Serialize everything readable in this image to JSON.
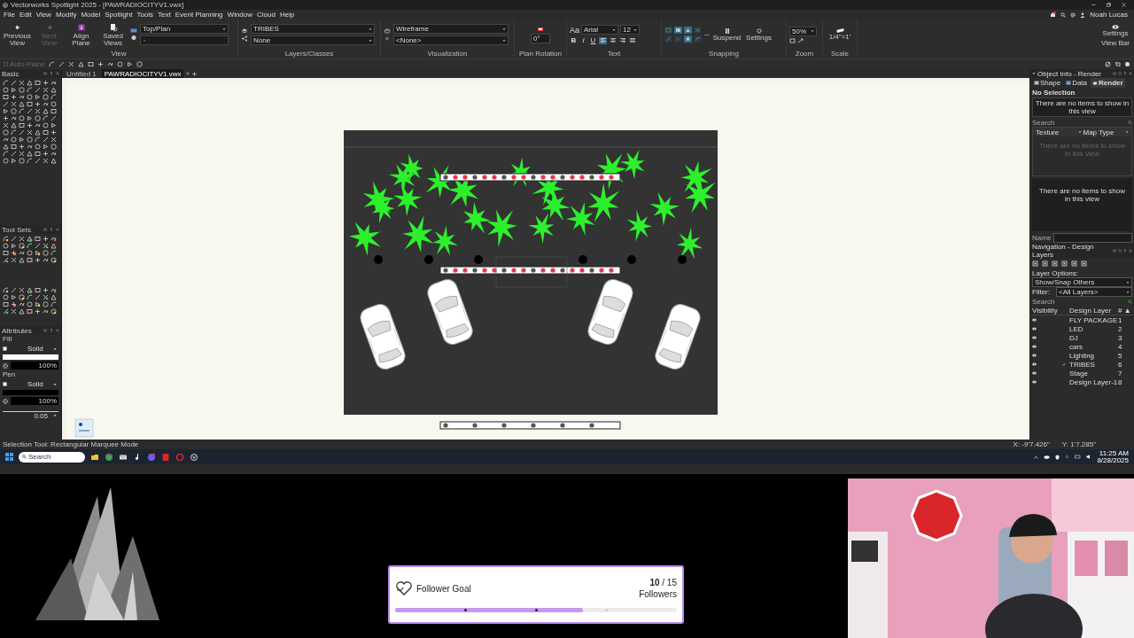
{
  "window": {
    "title": "Vectorworks Spotlight 2025 - [PAWRADIOCITYV1.vwx]"
  },
  "menu": [
    "File",
    "Edit",
    "View",
    "Modify",
    "Model",
    "Spotlight",
    "Tools",
    "Text",
    "Event Planning",
    "Window",
    "Cloud",
    "Help"
  ],
  "account": {
    "user": "Noah Lucas",
    "notification": true
  },
  "ribbon": {
    "view": {
      "caption": "View",
      "view": "Top/Plan",
      "buttons": [
        {
          "label": "Previous View",
          "disabled": false
        },
        {
          "label": "Next View",
          "disabled": true
        },
        {
          "label": "Align Plane",
          "disabled": false
        },
        {
          "label": "Saved Views",
          "disabled": false
        }
      ]
    },
    "layers_classes": {
      "caption": "Layers/Classes",
      "layer": "TRIBES",
      "class": "None"
    },
    "visualization": {
      "caption": "Visualization",
      "render_mode": "Wireframe",
      "option": "<None>"
    },
    "plan_rotation": {
      "caption": "Plan Rotation",
      "angle": "0°"
    },
    "text": {
      "caption": "Text",
      "glyph": "Aa",
      "font": "Arial",
      "size": "12",
      "styles": [
        "B",
        "I",
        "U"
      ],
      "alignments": [
        {
          "selected": true
        },
        {
          "selected": false
        },
        {
          "selected": false
        },
        {
          "selected": false
        }
      ]
    },
    "snapping": {
      "caption": "Snapping",
      "suspend": "Suspend",
      "settings": "Settings",
      "modes": [
        {
          "on": false
        },
        {
          "on": true
        },
        {
          "on": true
        },
        {
          "on": false
        },
        {
          "on": false
        },
        {
          "on": false
        },
        {
          "on": true
        },
        {
          "on": false
        }
      ]
    },
    "zoom": {
      "caption": "Zoom",
      "value": "50%"
    },
    "scale": {
      "caption": "Scale",
      "value": "1/4\"=1'"
    },
    "view_bar": {
      "settings": "Settings",
      "label": "View Bar"
    }
  },
  "toolbar": {
    "auto_plane": {
      "label": "Auto-Plane",
      "disabled": true
    }
  },
  "document_tabs": [
    {
      "label": "Untitled 1",
      "selected": false
    },
    {
      "label": "PAWRADIOCITYV1.vwx",
      "selected": true
    }
  ],
  "palettes": {
    "basic": "Basic",
    "tool_sets": "Tool Sets",
    "attributes": {
      "title": "Attributes",
      "fill_label": "Fill",
      "fill_style": "Solid",
      "fill_opacity": "100%",
      "pen_label": "Pen",
      "pen_style": "Solid",
      "pen_opacity": "100%",
      "line_weight": "0.05"
    }
  },
  "object_info": {
    "title": "Object Info - Render",
    "tabs": [
      {
        "label": "Shape",
        "selected": false
      },
      {
        "label": "Data",
        "selected": false
      },
      {
        "label": "Render",
        "selected": true
      }
    ],
    "selection": "No Selection",
    "message": "There are no items to show in this view",
    "search_label": "Search",
    "columns": [
      "Texture",
      "Map Type"
    ],
    "table_message": "There are no items to show in this view",
    "panel_message": "There are no items to show in this view",
    "name_label": "Name"
  },
  "navigation": {
    "title": "Navigation - Design Layers",
    "layer_options_label": "Layer Options:",
    "layer_options": "Show/Snap Others",
    "filter_label": "Filter:",
    "filter": "<All Layers>",
    "search_label": "Search",
    "columns": [
      "Visibility",
      "Design Layer",
      "# ▲"
    ],
    "layers": [
      {
        "name": "FLY PACKAGE",
        "number": "1",
        "visible": true,
        "active": false
      },
      {
        "name": "LED",
        "number": "2",
        "visible": true,
        "active": false
      },
      {
        "name": "DJ",
        "number": "3",
        "visible": true,
        "active": false
      },
      {
        "name": "cars",
        "number": "4",
        "visible": true,
        "active": false
      },
      {
        "name": "Lighting",
        "number": "5",
        "visible": true,
        "active": false
      },
      {
        "name": "TRIBES",
        "number": "6",
        "visible": true,
        "active": true
      },
      {
        "name": "Stage",
        "number": "7",
        "visible": true,
        "active": false
      },
      {
        "name": "Design Layer-1",
        "number": "8",
        "visible": true,
        "active": false
      }
    ]
  },
  "status_bar": {
    "message": "Selection Tool: Rectangular Marquee Mode",
    "x": "X: -9'7.426\"",
    "y": "Y: 1'7.285\""
  },
  "taskbar": {
    "search_placeholder": "Search",
    "time": "11:25 AM",
    "date": "8/28/2025"
  },
  "goal": {
    "title": "Follower Goal",
    "count": "**10** / 15",
    "unit": "Followers",
    "level": 0.667
  }
}
